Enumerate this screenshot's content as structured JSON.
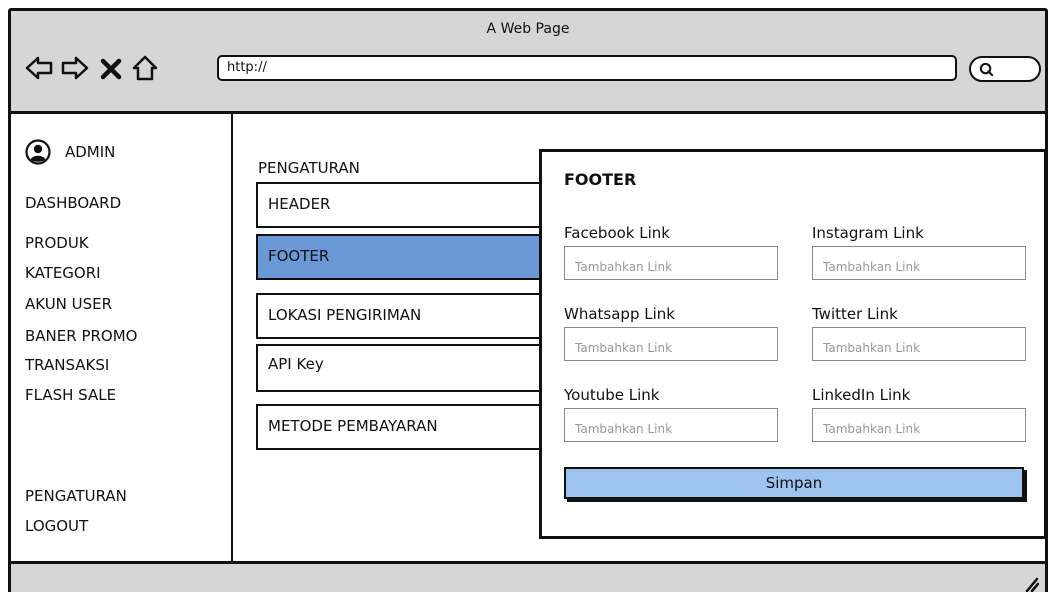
{
  "window": {
    "title": "A Web Page",
    "url": "http://"
  },
  "sidebar": {
    "admin_label": "ADMIN",
    "items": [
      "DASHBOARD",
      "PRODUK",
      "KATEGORI",
      "AKUN USER",
      "BANER PROMO",
      "TRANSAKSI",
      "FLASH SALE"
    ],
    "bottom_items": [
      "PENGATURAN",
      "LOGOUT"
    ]
  },
  "main": {
    "section_title": "PENGATURAN",
    "menu": [
      {
        "label": "HEADER",
        "active": false
      },
      {
        "label": "FOOTER",
        "active": true
      },
      {
        "label": "LOKASI PENGIRIMAN",
        "active": false
      },
      {
        "label": "API Key",
        "active": false
      },
      {
        "label": "METODE PEMBAYARAN",
        "active": false
      }
    ]
  },
  "panel": {
    "title": "FOOTER",
    "fields": [
      {
        "label": "Facebook Link",
        "placeholder": "Tambahkan Link"
      },
      {
        "label": "Instagram Link",
        "placeholder": "Tambahkan Link"
      },
      {
        "label": "Whatsapp Link",
        "placeholder": "Tambahkan Link"
      },
      {
        "label": "Twitter Link",
        "placeholder": "Tambahkan Link"
      },
      {
        "label": "Youtube Link",
        "placeholder": "Tambahkan Link"
      },
      {
        "label": "LinkedIn Link",
        "placeholder": "Tambahkan Link"
      }
    ],
    "save_label": "Simpan"
  },
  "colors": {
    "active_menu": "#6b98d6",
    "save_button": "#9dc3ee",
    "chrome": "#d6d6d6"
  },
  "icons": [
    "back-arrow-icon",
    "forward-arrow-icon",
    "close-icon",
    "home-icon",
    "search-icon",
    "user-avatar-icon",
    "resize-grip-icon"
  ]
}
